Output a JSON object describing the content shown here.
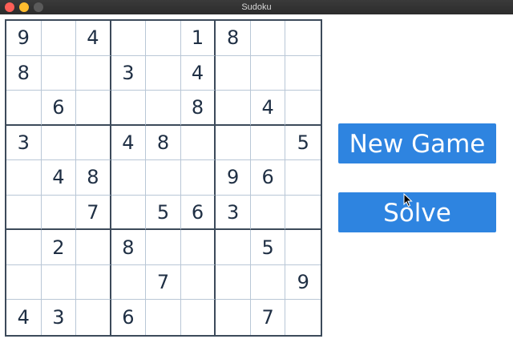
{
  "window": {
    "title": "Sudoku"
  },
  "board": {
    "cells": [
      [
        "9",
        "",
        "4",
        "",
        "",
        "1",
        "8",
        "",
        ""
      ],
      [
        "8",
        "",
        "",
        "3",
        "",
        "4",
        "",
        "",
        ""
      ],
      [
        "",
        "6",
        "",
        "",
        "",
        "8",
        "",
        "4",
        ""
      ],
      [
        "3",
        "",
        "",
        "4",
        "8",
        "",
        "",
        "",
        "5"
      ],
      [
        "",
        "4",
        "8",
        "",
        "",
        "",
        "9",
        "6",
        ""
      ],
      [
        "",
        "",
        "7",
        "",
        "5",
        "6",
        "3",
        "",
        ""
      ],
      [
        "",
        "2",
        "",
        "8",
        "",
        "",
        "",
        "5",
        ""
      ],
      [
        "",
        "",
        "",
        "",
        "7",
        "",
        "",
        "",
        "9"
      ],
      [
        "4",
        "3",
        "",
        "6",
        "",
        "",
        "",
        "7",
        ""
      ]
    ]
  },
  "buttons": {
    "new_game": "New Game",
    "solve": "Solve"
  },
  "colors": {
    "accent": "#2e84e0",
    "digit": "#1f2f44",
    "grid_thin": "#b9c7d6",
    "grid_thick": "#3c4a5a"
  }
}
